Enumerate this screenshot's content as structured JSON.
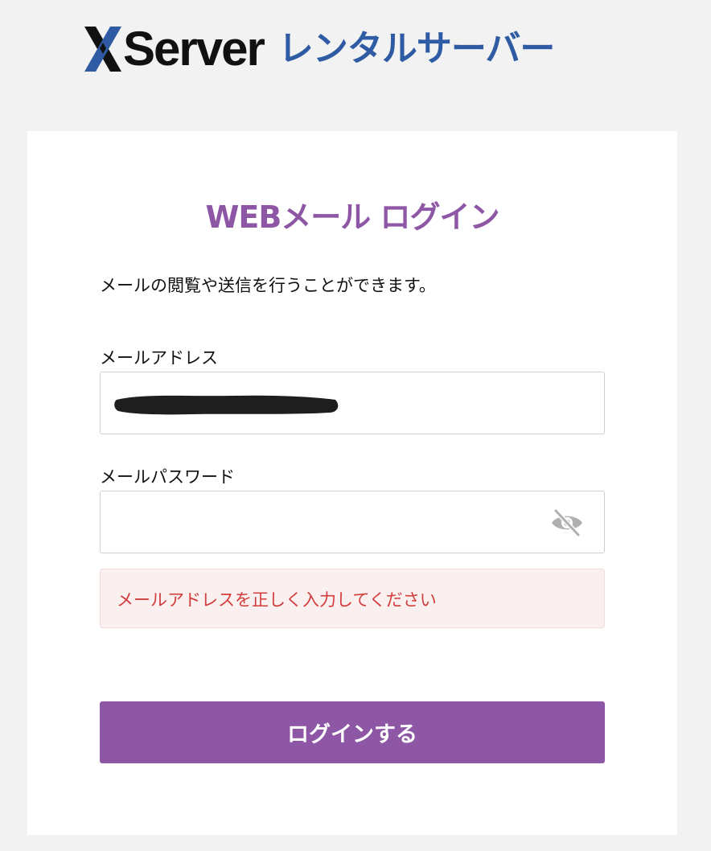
{
  "header": {
    "logo_word": "Server",
    "logo_sub": "レンタルサーバー"
  },
  "card": {
    "title": "WEBメール ログイン",
    "description": "メールの閲覧や送信を行うことができます。",
    "email": {
      "label": "メールアドレス",
      "value": ""
    },
    "password": {
      "label": "メールパスワード",
      "value": ""
    },
    "error_message": "メールアドレスを正しく入力してください",
    "login_button": "ログインする"
  },
  "colors": {
    "accent": "#8e57a6",
    "brand_blue": "#2e5ba3",
    "error_text": "#d23c3c",
    "error_bg": "#fbf0f0",
    "page_bg": "#f2f2f2"
  },
  "icons": {
    "password_toggle": "eye-slash-icon",
    "logo_mark": "xserver-x-icon"
  }
}
